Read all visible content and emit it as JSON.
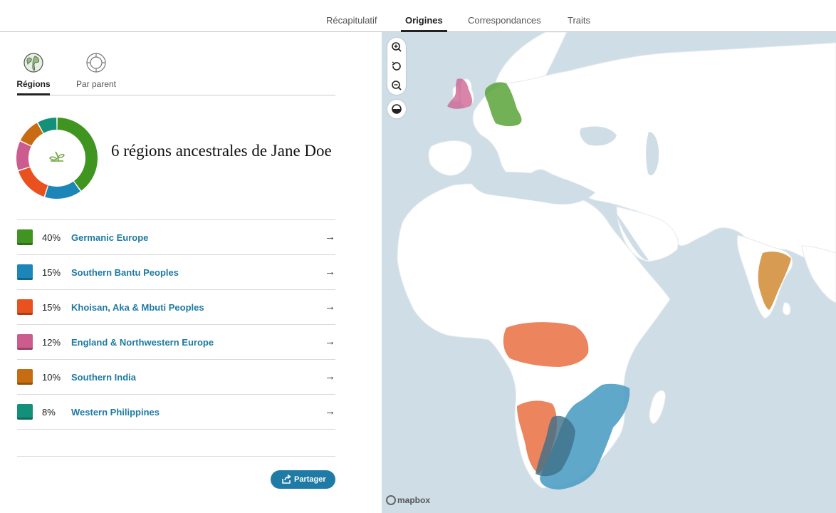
{
  "nav": {
    "tabs": [
      {
        "label": "Récapitulatif"
      },
      {
        "label": "Origines"
      },
      {
        "label": "Correspondances"
      },
      {
        "label": "Traits"
      }
    ]
  },
  "view_tabs": [
    {
      "label": "Régions",
      "icon": "globe-icon"
    },
    {
      "label": "Par parent",
      "icon": "parents-circle-icon"
    }
  ],
  "summary": {
    "heading": "6 régions ancestrales de Jane Doe",
    "center_icon": "sprout-icon"
  },
  "regions": [
    {
      "percent": "40%",
      "value": 40,
      "name": "Germanic Europe",
      "color": "#3f9520"
    },
    {
      "percent": "15%",
      "value": 15,
      "name": "Southern Bantu Peoples",
      "color": "#1c86b8"
    },
    {
      "percent": "15%",
      "value": 15,
      "name": "Khoisan, Aka & Mbuti Peoples",
      "color": "#e9511f"
    },
    {
      "percent": "12%",
      "value": 12,
      "name": "England & Northwestern Europe",
      "color": "#cc5c8d"
    },
    {
      "percent": "10%",
      "value": 10,
      "name": "Southern India",
      "color": "#c76c13"
    },
    {
      "percent": "8%",
      "value": 8,
      "name": "Western Philippines",
      "color": "#13907a"
    }
  ],
  "share": {
    "label": "Partager",
    "icon": "share-icon"
  },
  "map": {
    "attribution": "mapbox",
    "controls": [
      "zoom-in-icon",
      "reset-icon",
      "zoom-out-icon",
      "contrast-icon"
    ],
    "ocean_color": "#cfdde6",
    "land_color": "#ffffff"
  }
}
